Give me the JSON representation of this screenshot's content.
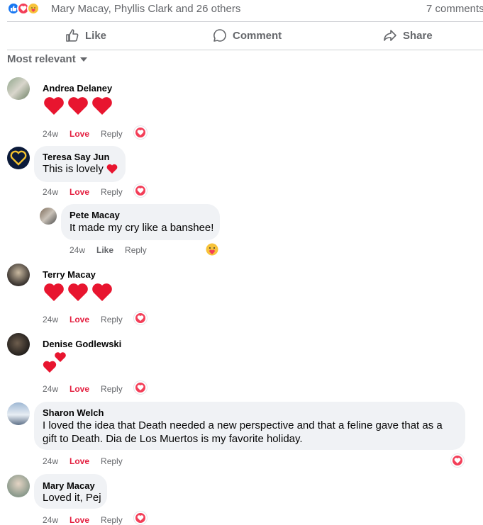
{
  "summary": {
    "reactions": [
      "like-icon",
      "love-icon",
      "care-icon"
    ],
    "names": "Mary Macay, Phyllis Clark and 26 others",
    "comment_count": "7 comments"
  },
  "actions": {
    "like": "Like",
    "comment": "Comment",
    "share": "Share"
  },
  "sort": {
    "label": "Most relevant"
  },
  "comments": [
    {
      "author": "Andrea Delaney",
      "text": "",
      "emoji": "❤️❤️❤️",
      "time": "24w",
      "reaction": "Love",
      "reply": "Reply",
      "badge": "love"
    },
    {
      "author": "Teresa Say Jun",
      "text": "This is lovely",
      "time": "24w",
      "reaction": "Love",
      "reply": "Reply",
      "badge": "love"
    },
    {
      "author": "Pete Macay",
      "text": "It made my cry like a banshee!",
      "time": "24w",
      "reaction": "Like",
      "reply": "Reply",
      "badge": "care"
    },
    {
      "author": "Terry Macay",
      "text": "",
      "emoji": "❤️❤️❤️",
      "time": "24w",
      "reaction": "Love",
      "reply": "Reply",
      "badge": "love"
    },
    {
      "author": "Denise Godlewski",
      "text": "",
      "emoji": "two-hearts",
      "time": "24w",
      "reaction": "Love",
      "reply": "Reply",
      "badge": "love"
    },
    {
      "author": "Sharon Welch",
      "text_line1": "I loved the idea that Death needed a new perspective and that a feline gave that as a",
      "text_line2": "gift to Death. Dia de Los Muertos is my favorite holiday.",
      "time": "24w",
      "reaction": "Love",
      "reply": "Reply",
      "badge": "love"
    },
    {
      "author": "Mary Macay",
      "text": "Loved it, Pej",
      "time": "24w",
      "reaction": "Love",
      "reply": "Reply",
      "badge": "love"
    }
  ],
  "colors": {
    "love": "#e41e3f",
    "heart": "#f33e58",
    "like_blue": "#1877f2",
    "muted": "#65676b",
    "bubble": "#f0f2f5"
  }
}
